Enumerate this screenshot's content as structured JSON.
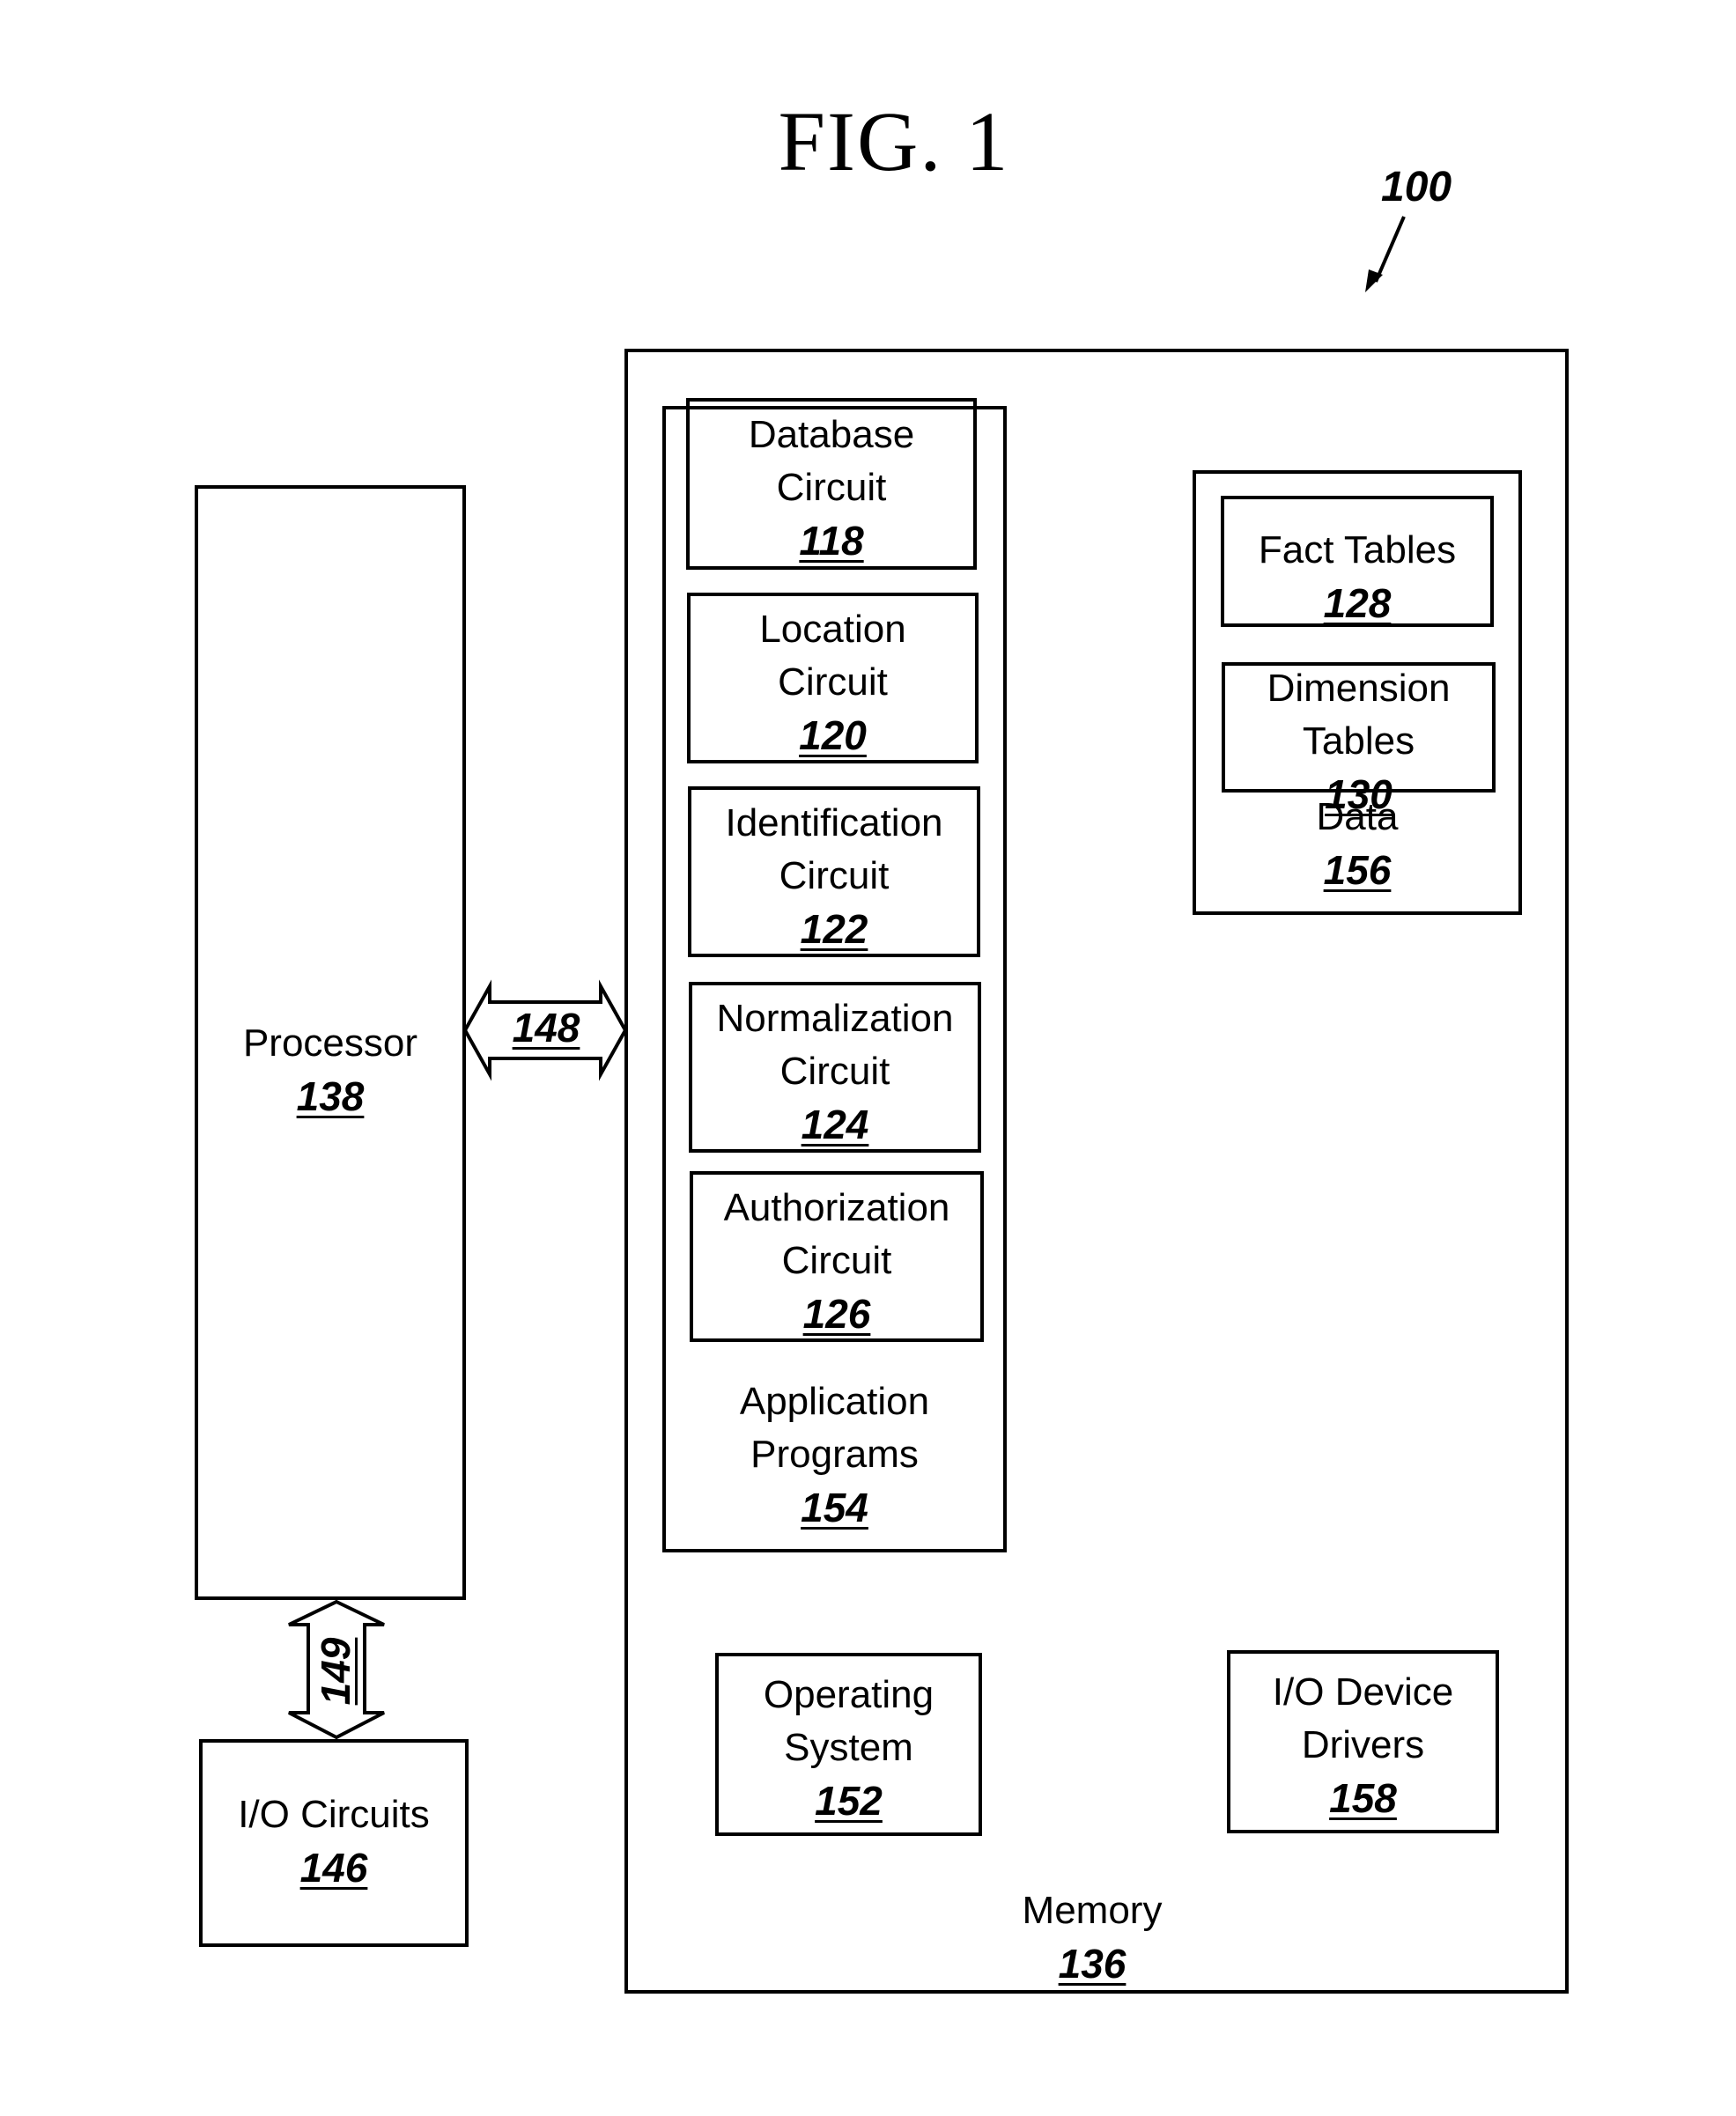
{
  "figure": {
    "title": "FIG. 1",
    "system_ref": "100"
  },
  "processor": {
    "label": "Processor",
    "ref": "138"
  },
  "io_circuits": {
    "label": "I/O Circuits",
    "ref": "146"
  },
  "bus_processor_memory": {
    "ref": "148"
  },
  "bus_processor_io": {
    "ref": "149"
  },
  "memory": {
    "label": "Memory",
    "ref": "136",
    "application_programs": {
      "label_line1": "Application",
      "label_line2": "Programs",
      "ref": "154",
      "circuits": [
        {
          "line1": "Database",
          "line2": "Circuit",
          "ref": "118"
        },
        {
          "line1": "Location",
          "line2": "Circuit",
          "ref": "120"
        },
        {
          "line1": "Identification",
          "line2": "Circuit",
          "ref": "122"
        },
        {
          "line1": "Normalization",
          "line2": "Circuit",
          "ref": "124"
        },
        {
          "line1": "Authorization",
          "line2": "Circuit",
          "ref": "126"
        }
      ]
    },
    "data": {
      "label": "Data",
      "ref": "156",
      "fact_tables": {
        "label": "Fact Tables",
        "ref": "128"
      },
      "dimension_tables": {
        "line1": "Dimension",
        "line2": "Tables",
        "ref": "130"
      }
    },
    "operating_system": {
      "line1": "Operating",
      "line2": "System",
      "ref": "152"
    },
    "io_device_drivers": {
      "line1": "I/O Device",
      "line2": "Drivers",
      "ref": "158"
    }
  }
}
